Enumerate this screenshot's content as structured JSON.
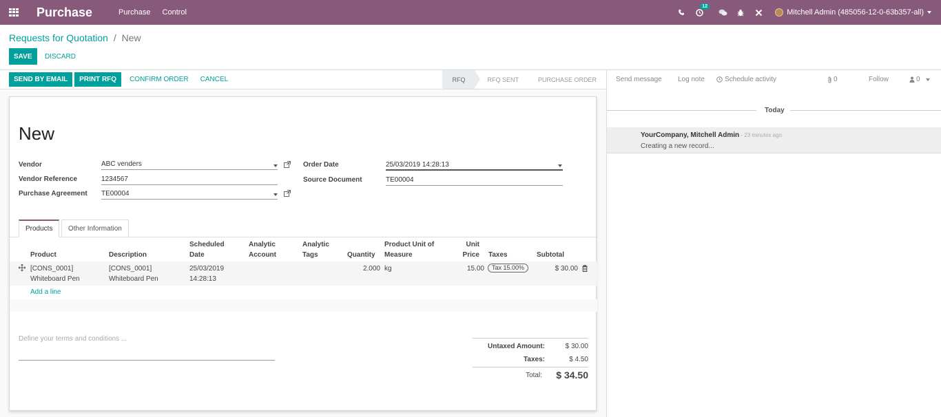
{
  "navbar": {
    "app_name": "Purchase",
    "menu": [
      "Purchase",
      "Control"
    ],
    "activity_count": "12",
    "user_name": "Mitchell Admin (485056-12-0-63b357-all)"
  },
  "breadcrumb": {
    "parent": "Requests for Quotation",
    "separator": "/",
    "current": "New"
  },
  "actions": {
    "save": "SAVE",
    "discard": "DISCARD"
  },
  "statusbar": {
    "buttons": [
      "SEND BY EMAIL",
      "PRINT RFQ",
      "CONFIRM ORDER",
      "CANCEL"
    ],
    "stages": [
      {
        "label": "RFQ",
        "active": true
      },
      {
        "label": "RFQ SENT",
        "active": false
      },
      {
        "label": "PURCHASE ORDER",
        "active": false
      }
    ]
  },
  "form": {
    "title": "New",
    "vendor_label": "Vendor",
    "vendor_value": "ABC venders",
    "vendor_ref_label": "Vendor Reference",
    "vendor_ref_value": "1234567",
    "agreement_label": "Purchase Agreement",
    "agreement_value": "TE00004",
    "order_date_label": "Order Date",
    "order_date_value": "25/03/2019 14:28:13",
    "source_doc_label": "Source Document",
    "source_doc_value": "TE00004"
  },
  "tabs": {
    "products": "Products",
    "other": "Other Information"
  },
  "table": {
    "headers": {
      "product": "Product",
      "description": "Description",
      "scheduled_1": "Scheduled",
      "scheduled_2": "Date",
      "analytic_acc_1": "Analytic",
      "analytic_acc_2": "Account",
      "analytic_tags_1": "Analytic",
      "analytic_tags_2": "Tags",
      "quantity": "Quantity",
      "uom_1": "Product Unit of",
      "uom_2": "Measure",
      "unit_price_1": "Unit",
      "unit_price_2": "Price",
      "taxes": "Taxes",
      "subtotal": "Subtotal"
    },
    "row": {
      "product_1": "[CONS_0001]",
      "product_2": "Whiteboard Pen",
      "description_1": "[CONS_0001]",
      "description_2": "Whiteboard Pen",
      "date_1": "25/03/2019",
      "date_2": "14:28:13",
      "quantity": "2.000",
      "uom": "kg",
      "unit_price": "15.00",
      "tax": "Tax 15.00%",
      "subtotal": "$ 30.00"
    },
    "add_line": "Add a line"
  },
  "terms_placeholder": "Define your terms and conditions ...",
  "totals": {
    "untaxed_label": "Untaxed Amount:",
    "untaxed_value": "$ 30.00",
    "taxes_label": "Taxes:",
    "taxes_value": "$ 4.50",
    "total_label": "Total:",
    "total_value": "$ 34.50"
  },
  "chatter": {
    "send_message": "Send message",
    "log_note": "Log note",
    "schedule_activity": "Schedule activity",
    "attachments": "0",
    "follow": "Follow",
    "followers": "0",
    "today": "Today",
    "message": {
      "author": "YourCompany, Mitchell Admin",
      "time": " - 23 minutes ago",
      "body": "Creating a new record..."
    }
  },
  "colors": {
    "brand": "#875a7b",
    "accent": "#00a09d"
  }
}
